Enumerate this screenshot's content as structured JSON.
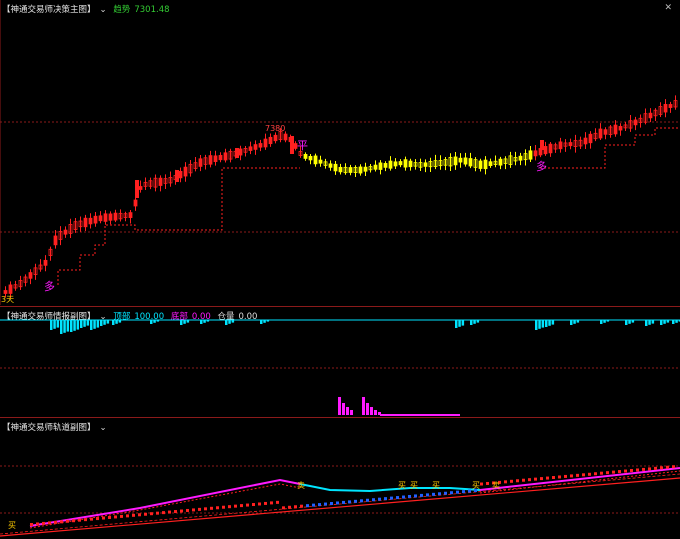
{
  "main_pane": {
    "title": "【神通交易师决策主图】",
    "indicator_label": "趋势",
    "indicator_value": "7301.48",
    "peak_label": "7380",
    "signal_flat": "平",
    "signal_long_1": "多",
    "signal_long_2": "多",
    "signal_buy_day": "3天",
    "close_icon": "close-icon"
  },
  "mid_pane": {
    "title": "【神通交易师情报副图】",
    "top_label": "顶部",
    "top_value": "100.00",
    "bottom_label": "底部",
    "bottom_value": "0.00",
    "position_label": "仓量",
    "position_value": "0.00"
  },
  "bot_pane": {
    "title": "【神通交易师轨道副图】",
    "markers": [
      "买",
      "卖",
      "买",
      "买",
      "买",
      "买",
      "卖"
    ]
  },
  "colors": {
    "up": "#ff2020",
    "flat": "#ffff00",
    "cyan": "#00e5ff",
    "magenta": "#ff1aff",
    "grid": "#8b1a1a"
  }
}
